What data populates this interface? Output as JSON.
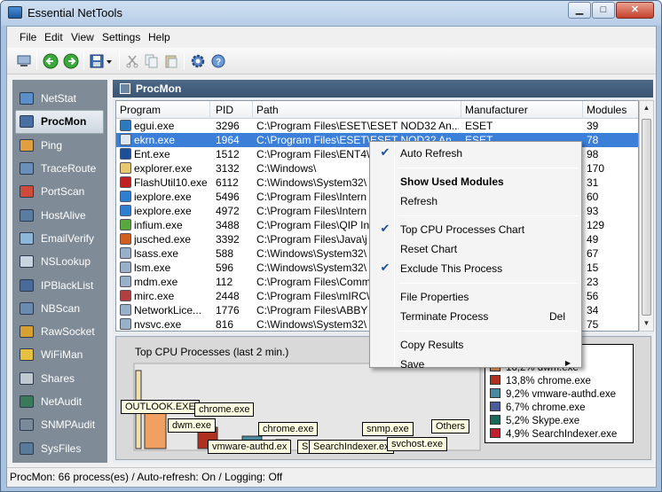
{
  "window": {
    "title": "Essential NetTools",
    "min": "▁",
    "max": "□",
    "close": "✕"
  },
  "menu": [
    "File",
    "Edit",
    "View",
    "Settings",
    "Help"
  ],
  "sidebar": {
    "items": [
      {
        "label": "NetStat",
        "icon": "netstat-icon",
        "color": "#5b8fc9"
      },
      {
        "label": "ProcMon",
        "icon": "procmon-icon",
        "color": "#4a6fa5",
        "selected": true
      },
      {
        "label": "Ping",
        "icon": "ping-icon",
        "color": "#e0a040"
      },
      {
        "label": "TraceRoute",
        "icon": "traceroute-icon",
        "color": "#6a8fb8"
      },
      {
        "label": "PortScan",
        "icon": "portscan-icon",
        "color": "#d04a3a"
      },
      {
        "label": "HostAlive",
        "icon": "hostalive-icon",
        "color": "#5a7ca0"
      },
      {
        "label": "EmailVerify",
        "icon": "emailverify-icon",
        "color": "#8db6d8"
      },
      {
        "label": "NSLookup",
        "icon": "nslookup-icon",
        "color": "#c8d4e0"
      },
      {
        "label": "IPBlackList",
        "icon": "ipblacklist-icon",
        "color": "#4a6a9a"
      },
      {
        "label": "NBScan",
        "icon": "nbscan-icon",
        "color": "#6a8ab0"
      },
      {
        "label": "RawSocket",
        "icon": "rawsocket-icon",
        "color": "#d8a030"
      },
      {
        "label": "WiFiMan",
        "icon": "wifiman-icon",
        "color": "#e8c040"
      },
      {
        "label": "Shares",
        "icon": "shares-icon",
        "color": "#c0c8d0"
      },
      {
        "label": "NetAudit",
        "icon": "netaudit-icon",
        "color": "#3a7a5a"
      },
      {
        "label": "SNMPAudit",
        "icon": "snmpaudit-icon",
        "color": "#7a8a9a"
      },
      {
        "label": "SysFiles",
        "icon": "sysfiles-icon",
        "color": "#5a7a9a"
      }
    ]
  },
  "panel": {
    "title": "ProcMon"
  },
  "table": {
    "columns": [
      "Program",
      "PID",
      "Path",
      "Manufacturer",
      "Modules"
    ],
    "rows": [
      {
        "program": "egui.exe",
        "pid": "3296",
        "path": "C:\\Program Files\\ESET\\ESET NOD32 An...",
        "manufacturer": "ESET",
        "modules": "39",
        "icon": "#2a7abf"
      },
      {
        "program": "ekrn.exe",
        "pid": "1964",
        "path": "C:\\Program Files\\ESET\\ESET NOD32 An...",
        "manufacturer": "ESET",
        "modules": "78",
        "icon": "#dfe8f0",
        "selected": true
      },
      {
        "program": "Ent.exe",
        "pid": "1512",
        "path": "C:\\Program Files\\ENT4\\",
        "manufacturer": "",
        "modules": "98",
        "icon": "#1c4f9a"
      },
      {
        "program": "explorer.exe",
        "pid": "3132",
        "path": "C:\\Windows\\",
        "manufacturer": "",
        "modules": "170",
        "icon": "#e8c870"
      },
      {
        "program": "FlashUtil10.exe",
        "pid": "6112",
        "path": "C:\\Windows\\System32\\",
        "manufacturer": "",
        "modules": "31",
        "icon": "#c02020"
      },
      {
        "program": "iexplore.exe",
        "pid": "5496",
        "path": "C:\\Program Files\\Intern",
        "manufacturer": "",
        "modules": "60",
        "icon": "#2e7fd0"
      },
      {
        "program": "iexplore.exe",
        "pid": "4972",
        "path": "C:\\Program Files\\Intern",
        "manufacturer": "",
        "modules": "93",
        "icon": "#2e7fd0"
      },
      {
        "program": "infium.exe",
        "pid": "3488",
        "path": "C:\\Program Files\\QIP In",
        "manufacturer": "",
        "modules": "129",
        "icon": "#58a840"
      },
      {
        "program": "jusched.exe",
        "pid": "3392",
        "path": "C:\\Program Files\\Java\\j",
        "manufacturer": "",
        "modules": "49",
        "icon": "#d06020"
      },
      {
        "program": "lsass.exe",
        "pid": "588",
        "path": "C:\\Windows\\System32\\",
        "manufacturer": "",
        "modules": "67",
        "icon": "#9ab0c8"
      },
      {
        "program": "lsm.exe",
        "pid": "596",
        "path": "C:\\Windows\\System32\\",
        "manufacturer": "",
        "modules": "15",
        "icon": "#9ab0c8"
      },
      {
        "program": "mdm.exe",
        "pid": "112",
        "path": "C:\\Program Files\\Comm",
        "manufacturer": "",
        "modules": "23",
        "icon": "#9ab0c8"
      },
      {
        "program": "mirc.exe",
        "pid": "2448",
        "path": "C:\\Program Files\\mIRC\\",
        "manufacturer": "",
        "modules": "56",
        "icon": "#b04040"
      },
      {
        "program": "NetworkLice...",
        "pid": "1776",
        "path": "C:\\Program Files\\ABBY",
        "manufacturer": "",
        "modules": "34",
        "icon": "#9ab0c8"
      },
      {
        "program": "nvsvc.exe",
        "pid": "816",
        "path": "C:\\Windows\\System32\\",
        "manufacturer": "",
        "modules": "75",
        "icon": "#9ab0c8"
      }
    ]
  },
  "context_menu": {
    "items": [
      {
        "label": "Auto Refresh",
        "checked": true
      },
      {
        "separator": true
      },
      {
        "label": "Show Used Modules",
        "bold": true
      },
      {
        "label": "Refresh"
      },
      {
        "separator": true
      },
      {
        "label": "Top CPU Processes Chart",
        "checked": true
      },
      {
        "label": "Reset Chart"
      },
      {
        "label": "Exclude This Process",
        "checked": true
      },
      {
        "separator": true
      },
      {
        "label": "File Properties"
      },
      {
        "label": "Terminate Process",
        "shortcut": "Del"
      },
      {
        "separator": true
      },
      {
        "label": "Copy Results"
      },
      {
        "label": "Save",
        "submenu": true
      }
    ]
  },
  "cpu_chart": {
    "title": "Top CPU Processes (last 2 min.)",
    "labels": [
      "OUTLOOK.EXE",
      "chrome.exe",
      "dwm.exe",
      "chrome.exe",
      "snmp.exe",
      "Others",
      "vmware-authd.ex",
      "Sk",
      "SearchIndexer.ex",
      "svchost.exe"
    ]
  },
  "chart_data": {
    "type": "bar",
    "title": "Top CPU Processes (last 2 min.)",
    "categories": [
      "OUTLOOK.EXE",
      "dwm.exe",
      "chrome.exe",
      "vmware-authd.exe",
      "Skype.exe",
      "SearchIndexer.exe"
    ],
    "series": [
      {
        "values": [
          null,
          16.2,
          13.8,
          9.2,
          5.2,
          4.9
        ]
      }
    ],
    "legend": [
      {
        "label": "OUTLOOK.EXE",
        "color": "#f0e0b0"
      },
      {
        "label": "16,2% dwm.exe",
        "color": "#f0a060"
      },
      {
        "label": "13,8% chrome.exe",
        "color": "#b03020"
      },
      {
        "label": "9,2% vmware-authd.exe",
        "color": "#4a8aa0"
      },
      {
        "label": "6,7% chrome.exe",
        "color": "#4a5a9a"
      },
      {
        "label": "5,2% Skype.exe",
        "color": "#1a6a5a"
      },
      {
        "label": "4,9% SearchIndexer.exe",
        "color": "#c02030"
      }
    ],
    "legend_position": "right"
  },
  "status": "ProcMon: 66 process(es) / Auto-refresh: On / Logging: Off"
}
